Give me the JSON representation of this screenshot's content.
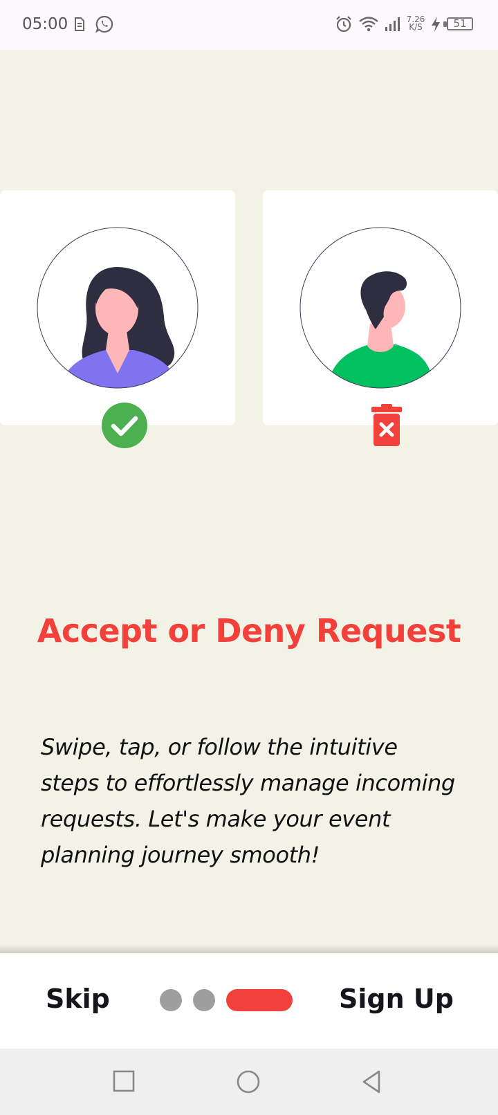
{
  "status_bar": {
    "time": "05:00",
    "net_speed_value": "7.26",
    "net_speed_unit": "K/S",
    "battery_level": "51",
    "icons": [
      "sim-icon",
      "whatsapp-icon",
      "alarm-icon",
      "wifi-icon",
      "signal-icon",
      "charging-icon",
      "battery-icon"
    ]
  },
  "illustration": {
    "accepted_avatar": "woman-avatar-icon",
    "denied_avatar": "man-avatar-icon",
    "accept_icon": "check-circle-icon",
    "deny_icon": "trash-icon"
  },
  "onboarding": {
    "title": "Accept or Deny Request",
    "description": "Swipe, tap, or follow the intuitive steps to effortlessly manage incoming requests. Let's make your event planning journey smooth!"
  },
  "footer": {
    "skip_label": "Skip",
    "signup_label": "Sign Up",
    "page_count": 3,
    "current_page": 3
  },
  "nav_bar": {
    "buttons": [
      "recents-button",
      "home-button",
      "back-button"
    ]
  },
  "colors": {
    "accent": "#f2403a",
    "background": "#f3f2e7",
    "accept_green": "#4caf50",
    "shirt_green": "#00c060",
    "shirt_purple": "#7f73f0"
  }
}
